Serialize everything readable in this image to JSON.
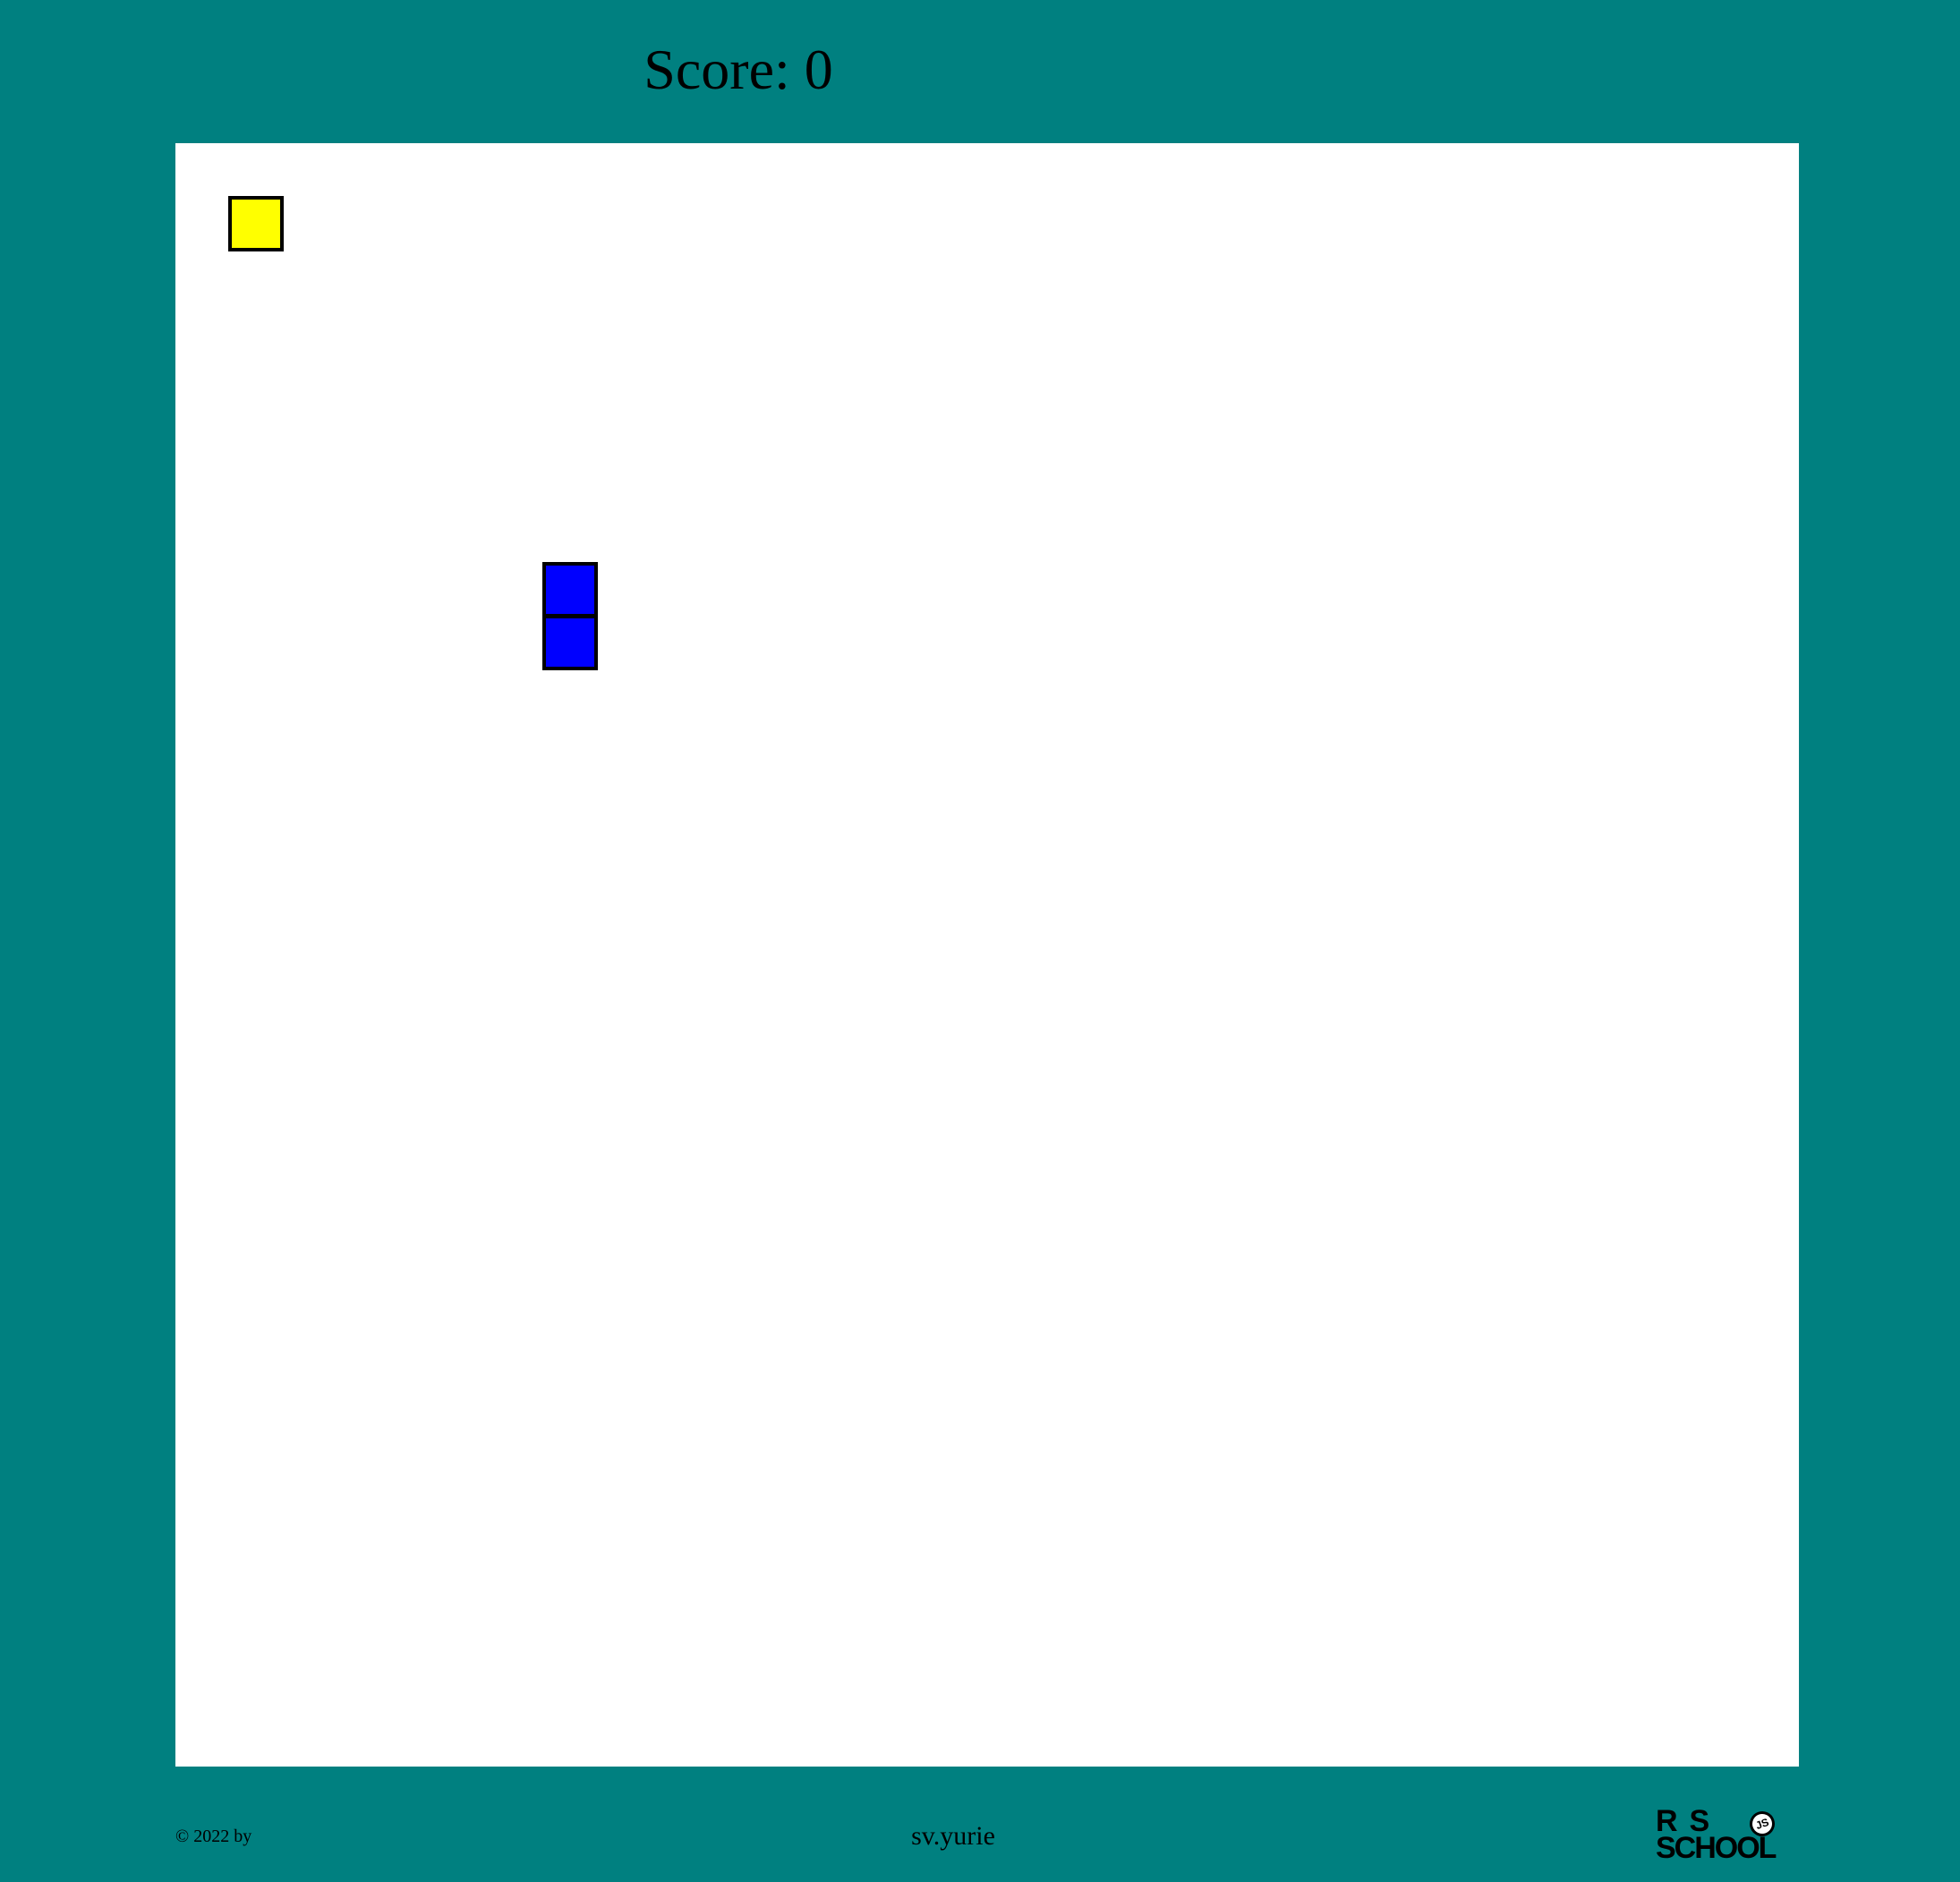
{
  "header": {
    "score_text": "Score: 0",
    "score_value": 0
  },
  "game": {
    "grid_cells": 31,
    "colors": {
      "page_background": "#008080",
      "board_background": "#ffffff",
      "food": "#ffff00",
      "snake": "#0000ff",
      "cell_border": "#000000"
    },
    "food": {
      "col": 1,
      "row": 1
    },
    "snake": [
      {
        "col": 7,
        "row": 8
      },
      {
        "col": 7,
        "row": 9
      }
    ]
  },
  "footer": {
    "copyright": "© 2022 by",
    "author": "sv.yurie",
    "logo_line1": "R  S",
    "logo_line2": "SCHOOL",
    "logo_badge": "JS"
  }
}
